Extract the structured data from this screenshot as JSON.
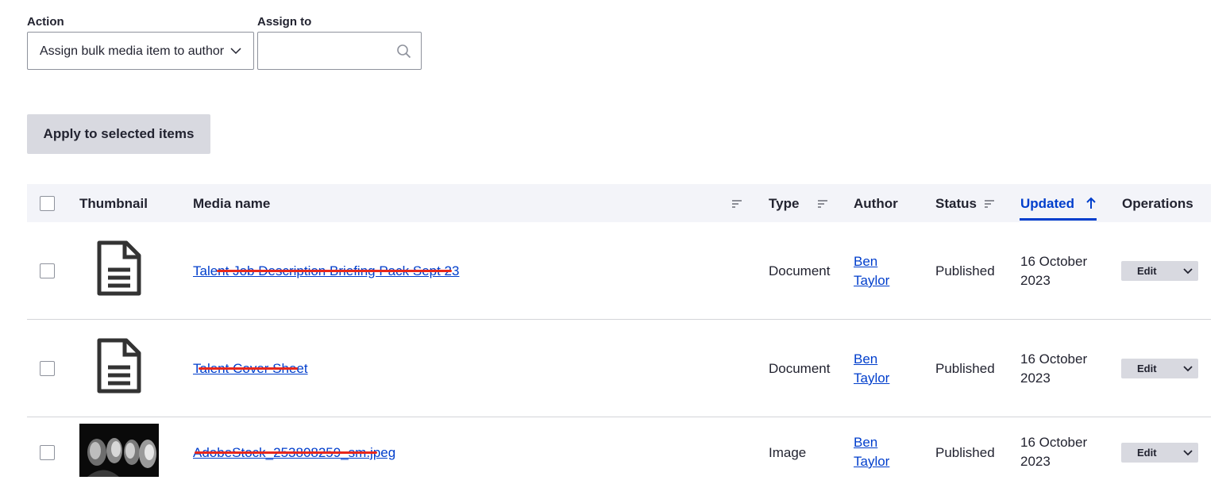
{
  "bulk_form": {
    "action_label": "Action",
    "action_value": "Assign bulk media item to author",
    "assign_label": "Assign to",
    "assign_value": "",
    "apply_button": "Apply to selected items"
  },
  "table": {
    "headers": {
      "thumbnail": "Thumbnail",
      "media_name": "Media name",
      "type": "Type",
      "author": "Author",
      "status": "Status",
      "updated": "Updated",
      "operations": "Operations"
    },
    "sorted_column": "updated",
    "sort_direction": "ascending",
    "rows": [
      {
        "thumbnail": "document-icon",
        "media_name": "Talent Job Description Briefing Pack Sept 23",
        "type": "Document",
        "author_first": "Ben",
        "author_last": "Taylor",
        "status": "Published",
        "updated_line1": "16 October",
        "updated_line2": "2023",
        "edit": "Edit"
      },
      {
        "thumbnail": "document-icon",
        "media_name": "Talent Cover Sheet",
        "type": "Document",
        "author_first": "Ben",
        "author_last": "Taylor",
        "status": "Published",
        "updated_line1": "16 October",
        "updated_line2": "2023",
        "edit": "Edit"
      },
      {
        "thumbnail": "image-thumbnail",
        "media_name": "AdobeStock_253808259_sm.jpeg",
        "type": "Image",
        "author_first": "Ben",
        "author_last": "Taylor",
        "status": "Published",
        "updated_line1": "16 October",
        "updated_line2": "2023",
        "edit": "Edit"
      }
    ]
  },
  "colors": {
    "link": "#003ecc",
    "header_bg": "#f3f4f9",
    "button_bg": "#d8d9e0",
    "redaction": "#e8281c"
  }
}
